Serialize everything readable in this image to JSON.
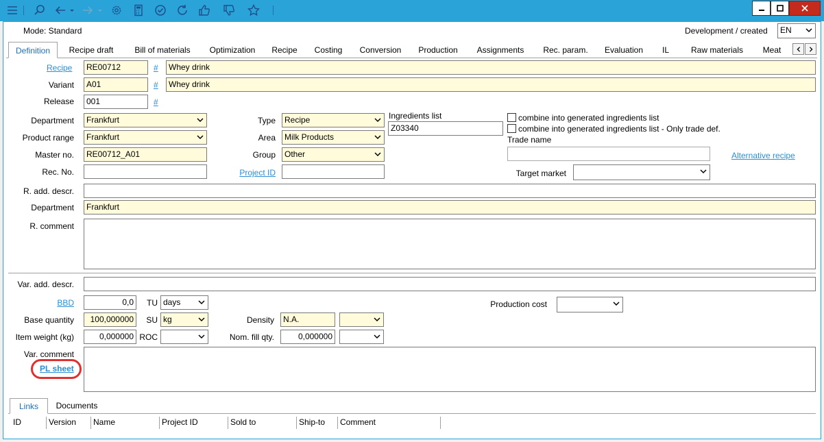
{
  "toolbar": {
    "icons": [
      "menu-icon",
      "search-icon",
      "back-arrow-icon",
      "dropdown-icon",
      "forward-arrow-icon",
      "dropdown-icon",
      "gear-icon",
      "calculator-icon",
      "check-circle-icon",
      "refresh-icon",
      "thumbs-up-icon",
      "thumbs-down-icon",
      "star-icon"
    ]
  },
  "window": {
    "minimize": "—",
    "maximize": "□",
    "close": "✕"
  },
  "header": {
    "mode": "Mode: Standard",
    "dev_label": "Development / created",
    "language": "EN"
  },
  "tabs": [
    "Definition",
    "Recipe draft",
    "Bill of materials",
    "Optimization",
    "Recipe",
    "Costing",
    "Conversion",
    "Production",
    "Assignments",
    "Rec. param.",
    "Evaluation",
    "IL",
    "Raw materials",
    "Meat"
  ],
  "form": {
    "recipe_label": "Recipe",
    "recipe_value": "RE00712",
    "recipe_name": "Whey drink",
    "variant_label": "Variant",
    "variant_value": "A01",
    "variant_name": "Whey drink",
    "release_label": "Release",
    "release_value": "001",
    "hash": "#",
    "department_label": "Department",
    "department_value": "Frankfurt",
    "product_range_label": "Product range",
    "product_range_value": "Frankfurt",
    "master_no_label": "Master no.",
    "master_no_value": "RE00712_A01",
    "rec_no_label": "Rec. No.",
    "rec_no_value": "",
    "type_label": "Type",
    "type_value": "Recipe",
    "area_label": "Area",
    "area_value": "Milk Products",
    "group_label": "Group",
    "group_value": "Other",
    "project_id_label": "Project ID",
    "project_id_value": "",
    "ingredients_label": "Ingredients list",
    "ingredients_value": "Z03340",
    "combine1": "combine into generated ingredients list",
    "combine2": "combine into generated ingredients list - Only trade def.",
    "trade_name_label": "Trade name",
    "trade_name_value": "",
    "alternative_recipe": "Alternative recipe",
    "target_market_label": "Target market",
    "target_market_value": "",
    "r_add_descr_label": "R. add. descr.",
    "r_add_descr_value": "",
    "department2_label": "Department",
    "department2_value": "Frankfurt",
    "r_comment_label": "R. comment",
    "var_add_descr_label": "Var. add. descr.",
    "var_add_descr_value": "",
    "bbd_label": "BBD",
    "bbd_value": "0,0",
    "tu_label": "TU",
    "tu_value": "days",
    "base_qty_label": "Base quantity",
    "base_qty_value": "100,000000",
    "su_label": "SU",
    "su_value": "kg",
    "item_weight_label": "Item weight (kg)",
    "item_weight_value": "0,000000",
    "roc_label": "ROC",
    "roc_value": "",
    "density_label": "Density",
    "density_value": "N.A.",
    "density_unit": "",
    "nom_fill_label": "Nom. fill qty.",
    "nom_fill_value": "0,000000",
    "nom_fill_unit": "",
    "production_cost_label": "Production cost",
    "production_cost_value": "",
    "var_comment_label": "Var. comment",
    "pl_sheet": "PL sheet"
  },
  "bottom": {
    "tabs": [
      "Links",
      "Documents"
    ],
    "columns": [
      "ID",
      "Version",
      "Name",
      "Project ID",
      "Sold to",
      "Ship-to",
      "Comment"
    ]
  },
  "colors": {
    "titlebar": "#29a3d8",
    "required_field": "#fffbdb",
    "link": "#2a8fd6",
    "highlight_circle": "#e03030"
  }
}
